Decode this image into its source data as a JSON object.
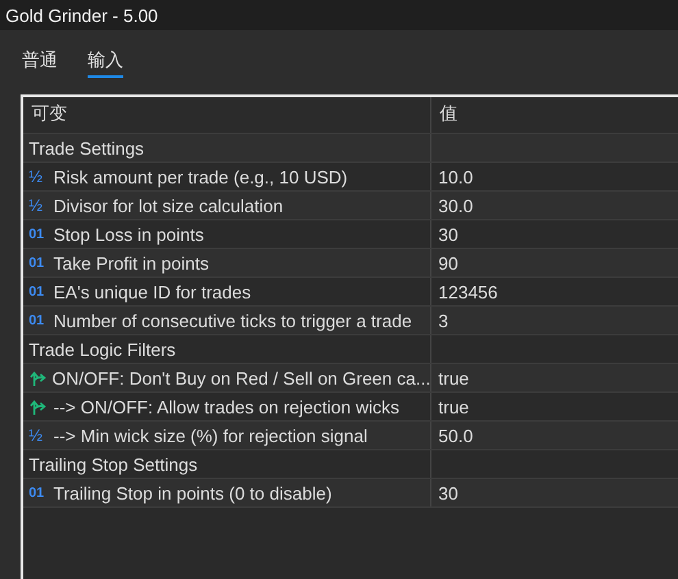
{
  "window": {
    "title": "Gold Grinder - 5.00"
  },
  "tabs": [
    {
      "label": "普通",
      "selected": false
    },
    {
      "label": "输入",
      "selected": true
    }
  ],
  "table": {
    "columns": [
      "可变",
      "值"
    ],
    "rows": [
      {
        "kind": "group",
        "label": "Trade Settings"
      },
      {
        "kind": "double",
        "icon": "½",
        "label": "Risk amount per trade (e.g., 10 USD)",
        "value": "10.0"
      },
      {
        "kind": "double",
        "icon": "½",
        "label": "Divisor for lot size calculation",
        "value": "30.0"
      },
      {
        "kind": "int",
        "icon": "01",
        "label": "Stop Loss in points",
        "value": "30"
      },
      {
        "kind": "int",
        "icon": "01",
        "label": "Take Profit in points",
        "value": "90"
      },
      {
        "kind": "int",
        "icon": "01",
        "label": "EA's unique ID for trades",
        "value": "123456"
      },
      {
        "kind": "int",
        "icon": "01",
        "label": "Number of consecutive ticks to trigger a trade",
        "value": "3"
      },
      {
        "kind": "group",
        "label": "Trade Logic Filters"
      },
      {
        "kind": "bool",
        "label": "ON/OFF: Don't Buy on Red / Sell on Green ca...",
        "value": "true"
      },
      {
        "kind": "bool",
        "label": "--> ON/OFF: Allow trades on rejection wicks",
        "value": "true"
      },
      {
        "kind": "double",
        "icon": "½",
        "label": "--> Min wick size (%) for rejection signal",
        "value": "50.0"
      },
      {
        "kind": "group",
        "label": "Trailing Stop Settings"
      },
      {
        "kind": "int",
        "icon": "01",
        "label": "Trailing Stop in points (0 to disable)",
        "value": "30"
      }
    ]
  }
}
